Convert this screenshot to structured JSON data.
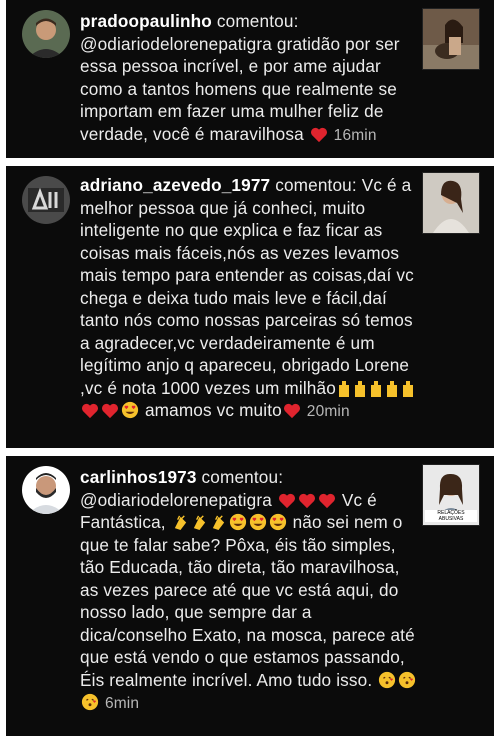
{
  "comments": [
    {
      "username": "pradoopaulinho",
      "action": "comentou:",
      "text": "@odiariodelorenepatigra gratidão por ser essa pessoa incrível, e por ame ajudar como a tantos homens que realmente se importam em fazer uma mulher feliz de verdade, você é maravilhosa",
      "time": "16min",
      "avatar_icon": "man-avatar-photo",
      "thumbnail_icon": "woman-with-dog-photo"
    },
    {
      "username": "adriano_azevedo_1977",
      "action": "comentou:",
      "text": "Vc é a melhor pessoa que já conheci, muito inteligente no que explica e faz ficar as coisas mais fáceis,nós as vezes levamos mais tempo para entender as coisas,daí vc chega e deixa tudo mais leve e fácil,daí tanto nós como nossas parceiras só temos a agradecer,vc verdadeiramente é um legítimo anjo q apareceu, obrigado Lorene ,vc é nota 1000 vezes um milhão",
      "text_after_emojis": "amamos vc muito",
      "time": "20min",
      "avatar_icon": "gym-logo-avatar",
      "thumbnail_icon": "woman-portrait-photo"
    },
    {
      "username": "carlinhos1973",
      "action": "comentou:",
      "mention": "@odiariodelorenepatigra",
      "text_a": "Vc é Fantástica,",
      "text_b": "não sei nem o que te falar sabe? Pôxa, éis tão simples, tão Educada, tão direta, tão maravilhosa, as vezes parece até que vc está aqui, do nosso lado, que sempre dar a dica/conselho Exato, na mosca,  parece até que está vendo o que estamos passando,  Éis realmente incrível.  Amo tudo isso.",
      "time": "6min",
      "avatar_icon": "man-with-beard-avatar",
      "thumbnail_icon": "relacoes-abusivas-thumbnail",
      "thumbnail_caption": "RELAÇÕES ABUSIVAS"
    }
  ],
  "colors": {
    "card_bg": "#0b0b0b",
    "heart": "#e0242e",
    "emoji_yellow": "#f6c12b"
  }
}
